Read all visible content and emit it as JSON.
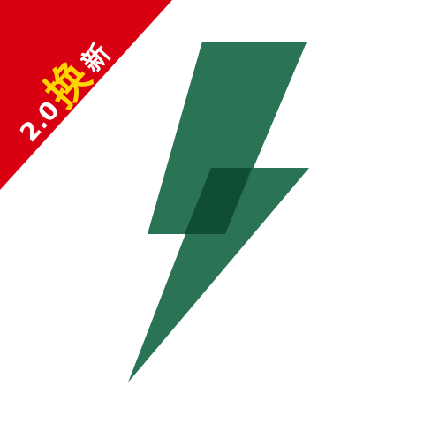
{
  "banner": {
    "prefix": "2.0",
    "highlight": "换",
    "suffix": "新"
  },
  "icon": {
    "name": "lightning-bolt-icon"
  },
  "colors": {
    "banner_red": "#d90012",
    "banner_text_white": "#ffffff",
    "banner_text_yellow": "#ffd400",
    "bolt_green": "#1f6b4b",
    "bolt_overlap": "#0f4e33",
    "background": "#ffffff"
  }
}
